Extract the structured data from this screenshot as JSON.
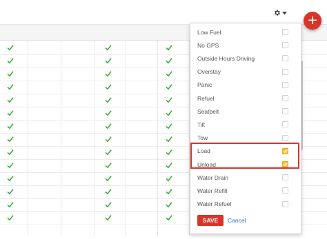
{
  "toolbar": {
    "settings_icon": "gear-icon",
    "caret_icon": "caret-down-icon",
    "add_label": "+",
    "add_color": "#d9342b"
  },
  "table": {
    "check_color": "#3cae3c",
    "checked_columns": 3,
    "row_count": 14
  },
  "dropdown": {
    "items": [
      {
        "label": "Low Fuel",
        "checked": false
      },
      {
        "label": "No GPS",
        "checked": false
      },
      {
        "label": "Outside Hours Driving",
        "checked": false
      },
      {
        "label": "Overstay",
        "checked": false
      },
      {
        "label": "Panic",
        "checked": false
      },
      {
        "label": "Refuel",
        "checked": false
      },
      {
        "label": "Seatbelt",
        "checked": false
      },
      {
        "label": "Tilt",
        "checked": false
      },
      {
        "label": "Tow",
        "checked": false
      },
      {
        "label": "Load",
        "checked": true
      },
      {
        "label": "Unload",
        "checked": true
      },
      {
        "label": "Water Drain",
        "checked": false
      },
      {
        "label": "Water Refill",
        "checked": false
      },
      {
        "label": "Water Refuel",
        "checked": false
      }
    ],
    "save_label": "SAVE",
    "cancel_label": "Cancel",
    "checked_color": "#f5c242",
    "highlight_color": "#d9342b"
  }
}
